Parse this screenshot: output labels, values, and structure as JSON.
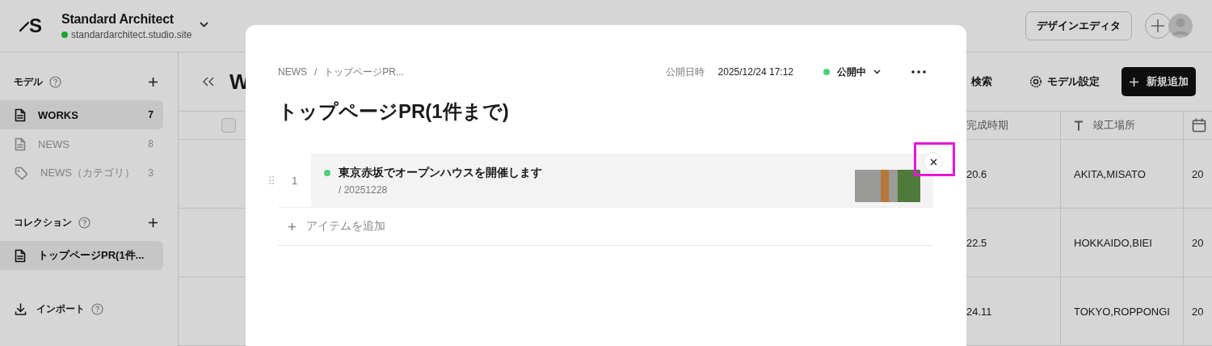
{
  "header": {
    "logo_text": "S",
    "site_name": "Standard Architect",
    "site_url": "standardarchitect.studio.site",
    "site_published": true,
    "design_editor_button": "デザインエディタ"
  },
  "sidebar": {
    "sections": [
      {
        "title": "モデル",
        "items": [
          {
            "label": "WORKS",
            "count": "7",
            "kind": "model",
            "selected": true
          },
          {
            "label": "NEWS",
            "count": "8",
            "kind": "model",
            "selected": false
          },
          {
            "label": "NEWS（カテゴリ）",
            "count": "3",
            "kind": "category",
            "selected": false
          }
        ]
      },
      {
        "title": "コレクション",
        "items": [
          {
            "label": "トップページPR(1件...",
            "kind": "collection",
            "selected": true
          }
        ]
      }
    ],
    "import_label": "インポート"
  },
  "main": {
    "title": "W",
    "search_label": "検索",
    "model_settings_label": "モデル設定",
    "add_button": "新規追加",
    "table": {
      "select_all_checked": false,
      "columns": [
        {
          "label": "完成時期",
          "kind": "plain"
        },
        {
          "label": "竣工場所",
          "kind": "text"
        },
        {
          "kind": "date"
        }
      ],
      "rows": [
        {
          "cells": [
            "20.6",
            "AKITA,MISATO",
            "20"
          ]
        },
        {
          "cells": [
            "22.5",
            "HOKKAIDO,BIEI",
            "20"
          ]
        },
        {
          "cells": [
            "24.11",
            "TOKYO,ROPPONGI",
            "20"
          ]
        }
      ]
    }
  },
  "modal": {
    "breadcrumb": [
      "NEWS",
      "トップページPR..."
    ],
    "breadcrumb_separator": "/",
    "publish_date_label": "公開日時",
    "publish_date": "2025/12/24 17:12",
    "status": {
      "label": "公開中",
      "published": true
    },
    "title": "トップページPR(1件まで)",
    "items": [
      {
        "number": "1",
        "title": "東京赤坂でオープンハウスを開催します",
        "subtitle": "/ 20251228",
        "published": true
      }
    ],
    "add_item_label": "アイテムを追加"
  }
}
